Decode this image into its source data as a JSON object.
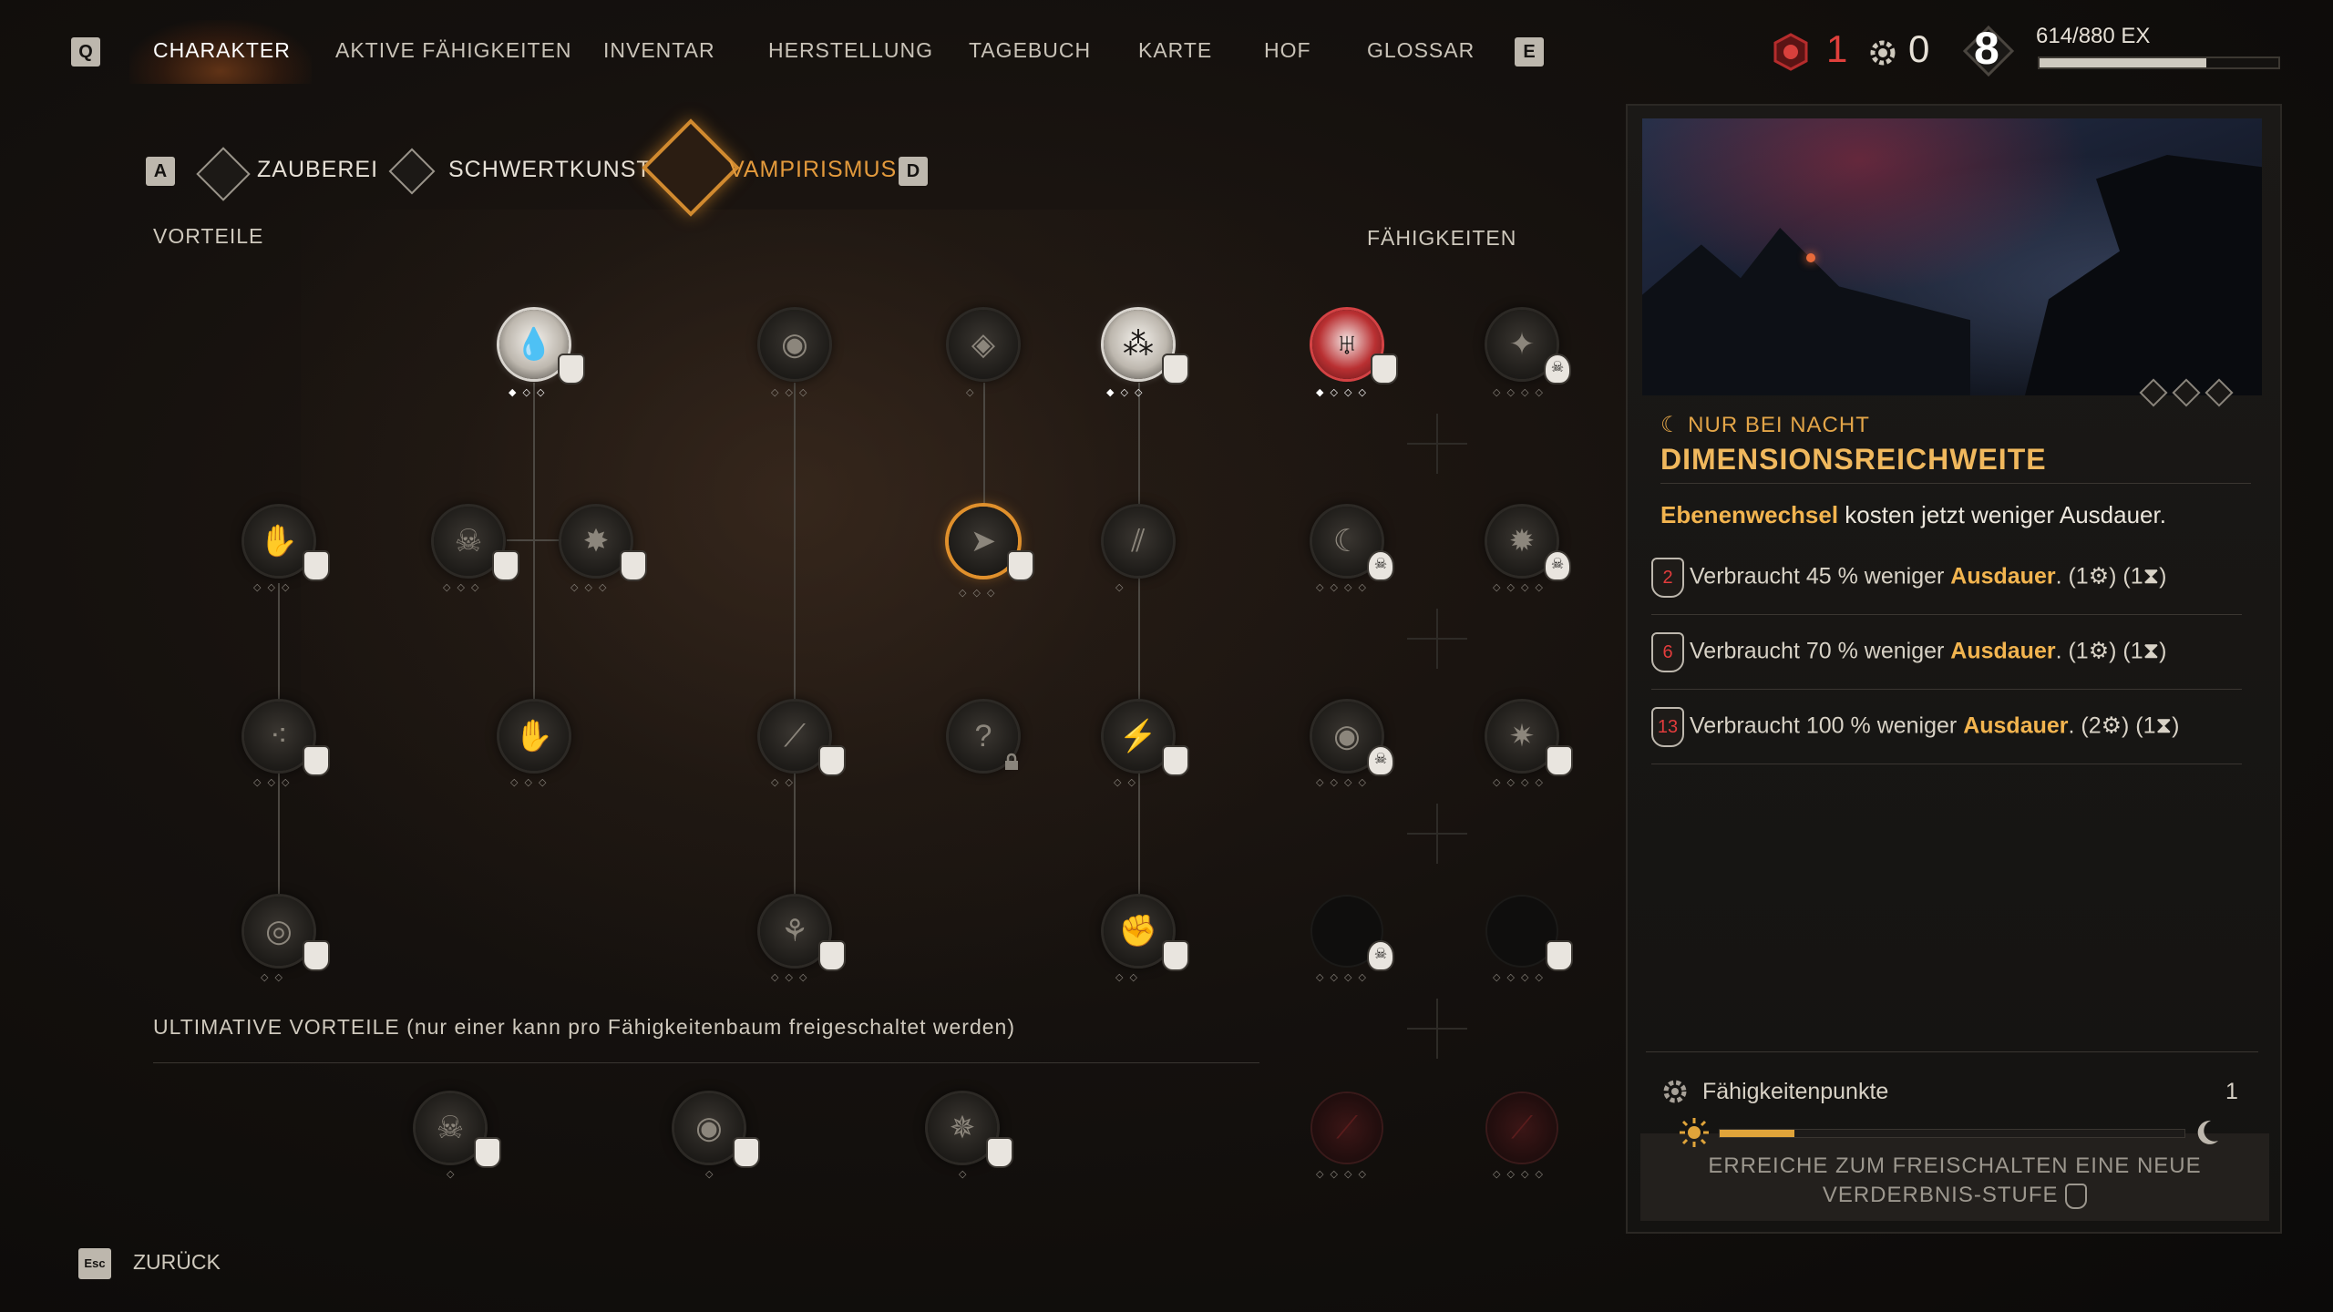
{
  "nav": {
    "left_key": "Q",
    "right_key": "E",
    "tabs": [
      "CHARAKTER",
      "AKTIVE FÄHIGKEITEN",
      "INVENTAR",
      "HERSTELLUNG",
      "TAGEBUCH",
      "KARTE",
      "HOF",
      "GLOSSAR"
    ],
    "active_tab": "CHARAKTER"
  },
  "stats": {
    "corruption": "1",
    "skill_points": "0",
    "level": "8",
    "xp_text": "614/880 EX",
    "xp_fraction": 0.698
  },
  "subtabs": {
    "left_key": "A",
    "right_key": "D",
    "items": [
      "ZAUBEREI",
      "SCHWERTKUNST",
      "VAMPIRISMUS"
    ],
    "active": "VAMPIRISMUS"
  },
  "labels": {
    "perks": "VORTEILE",
    "abilities": "FÄHIGKEITEN",
    "ultimates": "ULTIMATIVE VORTEILE (nur einer kann pro Fähigkeitenbaum freigeschaltet werden)"
  },
  "tree": {
    "locked_glyph": "?"
  },
  "detail": {
    "tag": "☾ NUR BEI NACHT",
    "title": "DIMENSIONSREICHWEITE",
    "desc_highlight": "Ebenenwechsel",
    "desc_rest": " kosten jetzt weniger Ausdauer.",
    "tiers": [
      {
        "level": "2",
        "text": "Verbraucht 45 % weniger ",
        "keyword": "Ausdauer",
        "cost": ". (1⚙) (1⧗)"
      },
      {
        "level": "6",
        "text": "Verbraucht 70 % weniger ",
        "keyword": "Ausdauer",
        "cost": ". (1⚙) (1⧗)"
      },
      {
        "level": "13",
        "text": "Verbraucht 100 % weniger ",
        "keyword": "Ausdauer",
        "cost": ". (2⚙) (1⧗)"
      }
    ],
    "skill_points_label": "Fähigkeitenpunkte",
    "skill_points_value": "1",
    "corruption_progress": 0.16,
    "unlock_line1": "ERREICHE ZUM FREISCHALTEN EINE NEUE",
    "unlock_line2": "VERDERBNIS-STUFE"
  },
  "footer": {
    "back_key": "Esc",
    "back_label": "ZURÜCK"
  }
}
